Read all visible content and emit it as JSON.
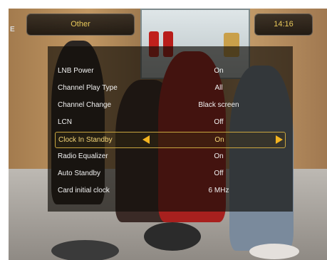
{
  "header": {
    "title": "Other",
    "clock": "14:16",
    "channel_logo": "E"
  },
  "menu": {
    "items": [
      {
        "label": "LNB Power",
        "value": "On"
      },
      {
        "label": "Channel Play Type",
        "value": "All"
      },
      {
        "label": "Channel Change",
        "value": "Black screen"
      },
      {
        "label": "LCN",
        "value": "Off"
      },
      {
        "label": "Clock In Standby",
        "value": "On",
        "selected": true
      },
      {
        "label": "Radio Equalizer",
        "value": "On"
      },
      {
        "label": "Auto Standby",
        "value": "Off"
      },
      {
        "label": "Card initial clock",
        "value": "6 MHz"
      }
    ]
  },
  "colors": {
    "accent": "#e8c85a",
    "arrow": "#f2b320",
    "selection_border": "#c9a640"
  }
}
